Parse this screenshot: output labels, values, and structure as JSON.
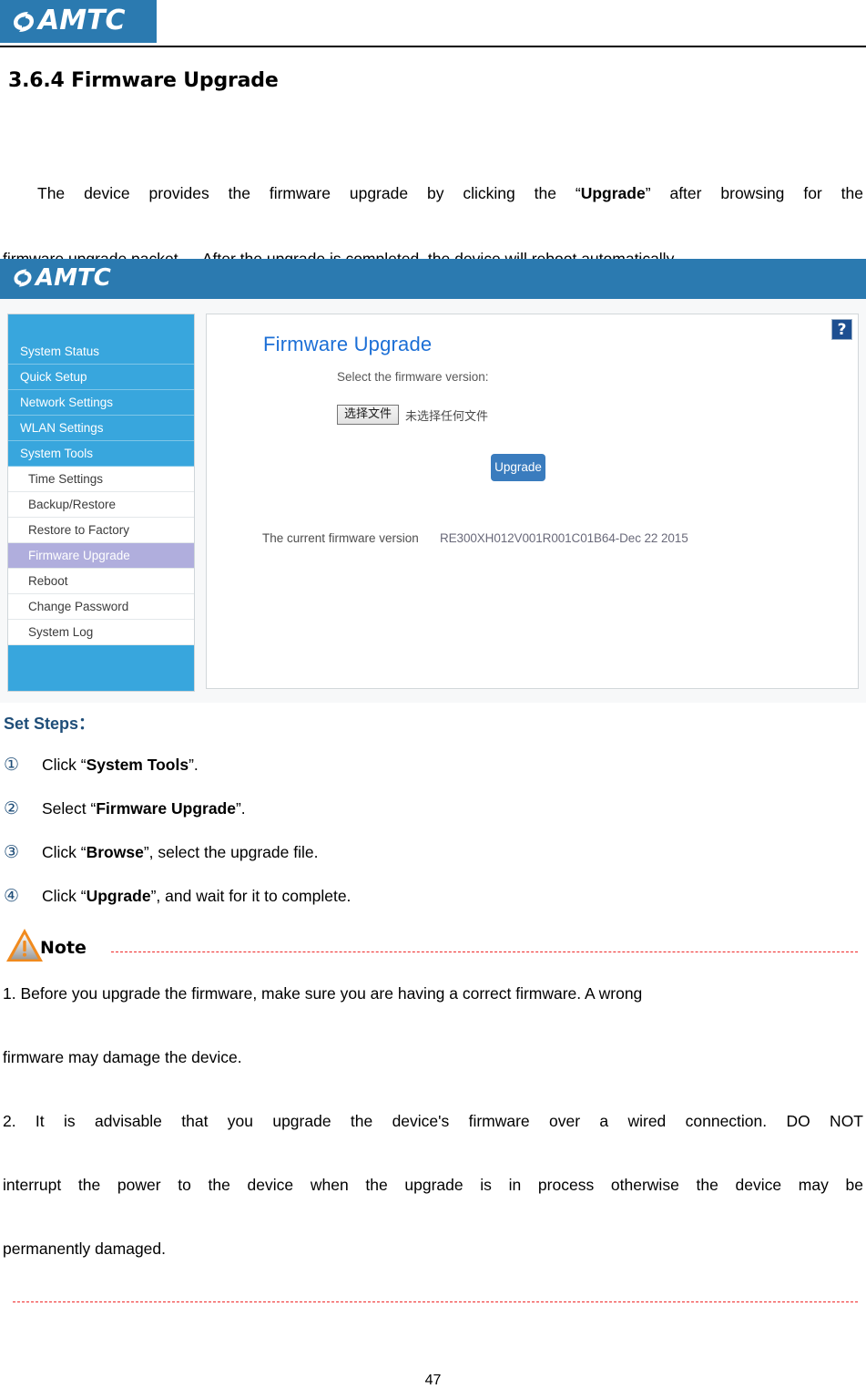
{
  "header": {
    "brand": "AMTC",
    "logo_bg": "#2b7ab0"
  },
  "section": {
    "heading": "3.6.4 Firmware Upgrade"
  },
  "intro": {
    "part1": "The device provides the firmware upgrade by clicking the “",
    "bold1": "Upgrade",
    "part2": "” after browsing for the",
    "part3": "firmware upgrade packet.  After the upgrade is completed, the device will reboot automatically."
  },
  "screenshot": {
    "brand": "AMTC",
    "nav": {
      "top_level": [
        {
          "label": "System Status"
        },
        {
          "label": "Quick Setup"
        },
        {
          "label": "Network Settings"
        },
        {
          "label": "WLAN Settings"
        },
        {
          "label": "System Tools"
        }
      ],
      "sub_items": [
        {
          "label": "Time Settings",
          "active": false
        },
        {
          "label": "Backup/Restore",
          "active": false
        },
        {
          "label": "Restore to Factory",
          "active": false
        },
        {
          "label": "Firmware Upgrade",
          "active": true
        },
        {
          "label": "Reboot",
          "active": false
        },
        {
          "label": "Change Password",
          "active": false
        },
        {
          "label": "System Log",
          "active": false
        }
      ]
    },
    "panel": {
      "title": "Firmware Upgrade",
      "help_label": "?",
      "select_label": "Select the firmware version:",
      "file_button": "选择文件",
      "file_status": "未选择任何文件",
      "upgrade_button": "Upgrade",
      "version_label": "The current firmware version",
      "version_value": "RE300XH012V001R001C01B64-Dec 22 2015"
    },
    "colors": {
      "topbar": "#2b7ab0",
      "nav_blue": "#38a6dd",
      "nav_active": "#b0aedd",
      "panel_title": "#1c6fd6",
      "upgrade_button": "#3a7cbe",
      "help_button": "#1d4f91"
    }
  },
  "steps_section": {
    "title": "Set Steps：",
    "items": [
      {
        "marker": "①",
        "pre": "Click “",
        "bold": "System Tools",
        "post": "”."
      },
      {
        "marker": "②",
        "pre": "Select “",
        "bold": "Firmware Upgrade",
        "post": "”."
      },
      {
        "marker": "③",
        "pre": "Click “",
        "bold": "Browse",
        "post": "”, select the upgrade file."
      },
      {
        "marker": "④",
        "pre": "Click “",
        "bold": "Upgrade",
        "post": "”, and wait for it to complete."
      }
    ]
  },
  "note": {
    "label": "Note",
    "line1": "1. Before you upgrade the firmware, make sure you are having a correct firmware. A wrong",
    "line2": "firmware may damage the device.",
    "line3": "2. It is advisable that you upgrade the device's firmware over a wired connection. DO NOT",
    "line4": "interrupt the power to the device when the upgrade is in process otherwise the device may be",
    "line5": "permanently damaged.",
    "rule_color": "#ef2929"
  },
  "footer": {
    "page_number": "47"
  }
}
